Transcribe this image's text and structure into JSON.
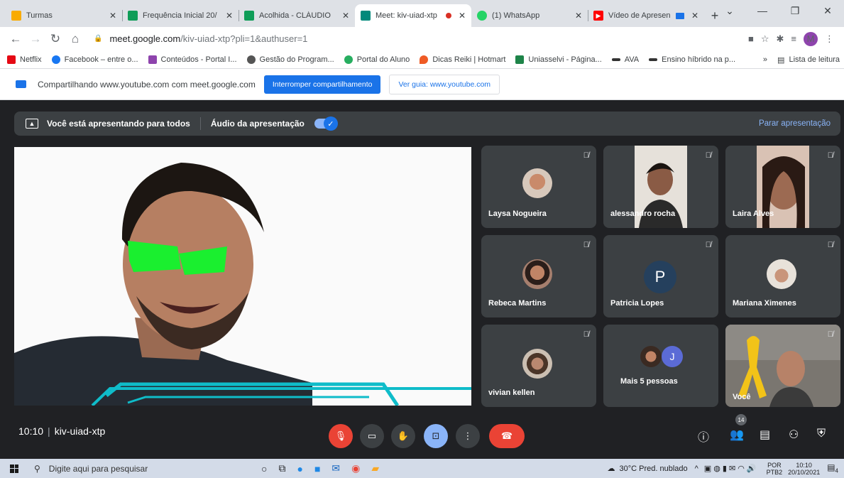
{
  "browser": {
    "tabs": [
      {
        "title": "Turmas",
        "icon": "classroom-icon",
        "color": "#f9ab00"
      },
      {
        "title": "Frequência Inicial 20/",
        "icon": "sheets-icon",
        "color": "#0f9d58"
      },
      {
        "title": "Acolhida - CLÁUDIO",
        "icon": "sheets-icon",
        "color": "#0f9d58"
      },
      {
        "title": "Meet: kiv-uiad-xtp",
        "icon": "meet-icon",
        "color": "#00897b",
        "active": true
      },
      {
        "title": "(1) WhatsApp",
        "icon": "whatsapp-icon",
        "color": "#25d366"
      },
      {
        "title": "Vídeo de Apresen",
        "icon": "youtube-icon",
        "color": "#ff0000"
      }
    ],
    "url_host": "meet.google.com",
    "url_rest": "/kiv-uiad-xtp?pli=1&authuser=1",
    "profile_initial": "M",
    "bookmarks": [
      {
        "label": "Netflix",
        "color": "#e50914"
      },
      {
        "label": "Facebook – entre o...",
        "color": "#1877f2"
      },
      {
        "label": "Conteúdos - Portal I...",
        "color": "#8e44ad"
      },
      {
        "label": "Gestão do Program...",
        "color": "#555555"
      },
      {
        "label": "Portal do Aluno",
        "color": "#27ae60"
      },
      {
        "label": "Dicas Reiki | Hotmart",
        "color": "#ef5b25"
      },
      {
        "label": "Uniasselvi - Página...",
        "color": "#1e8449"
      },
      {
        "label": "AVA",
        "color": "#333333"
      },
      {
        "label": "Ensino híbrido na p...",
        "color": "#333333"
      }
    ],
    "more_bookmarks": "»",
    "reading_list": "Lista de leitura"
  },
  "sharing": {
    "text": "Compartilhando www.youtube.com com meet.google.com",
    "stop_button": "Interromper compartilhamento",
    "guide_button": "Ver guia: www.youtube.com"
  },
  "meet": {
    "presenting_text": "Você está apresentando para todos",
    "audio_label": "Áudio da apresentação",
    "audio_enabled": true,
    "stop_presenting": "Parar apresentação",
    "time": "10:10",
    "meeting_code": "kiv-uiad-xtp",
    "participant_count": "14",
    "participants": [
      {
        "name": "Laysa Nogueira",
        "type": "avatar",
        "muted": true
      },
      {
        "name": "alessandro rocha",
        "type": "video",
        "muted": true
      },
      {
        "name": "Laira Alves",
        "type": "video",
        "muted": true
      },
      {
        "name": "Rebeca Martins",
        "type": "avatar",
        "muted": true
      },
      {
        "name": "Patricia Lopes",
        "type": "letter",
        "letter": "P",
        "muted": true
      },
      {
        "name": "Mariana Ximenes",
        "type": "avatar",
        "muted": true
      },
      {
        "name": "vivian kellen",
        "type": "avatar",
        "muted": true
      },
      {
        "name": "Mais 5 pessoas",
        "type": "group",
        "letter": "J"
      },
      {
        "name": "Você",
        "type": "video",
        "muted": true
      }
    ]
  },
  "taskbar": {
    "search_placeholder": "Digite aqui para pesquisar",
    "weather": "30°C  Pred. nublado",
    "language_top": "POR",
    "language_bottom": "PTB2",
    "clock_time": "10:10",
    "clock_date": "20/10/2021",
    "notifications": "4"
  }
}
